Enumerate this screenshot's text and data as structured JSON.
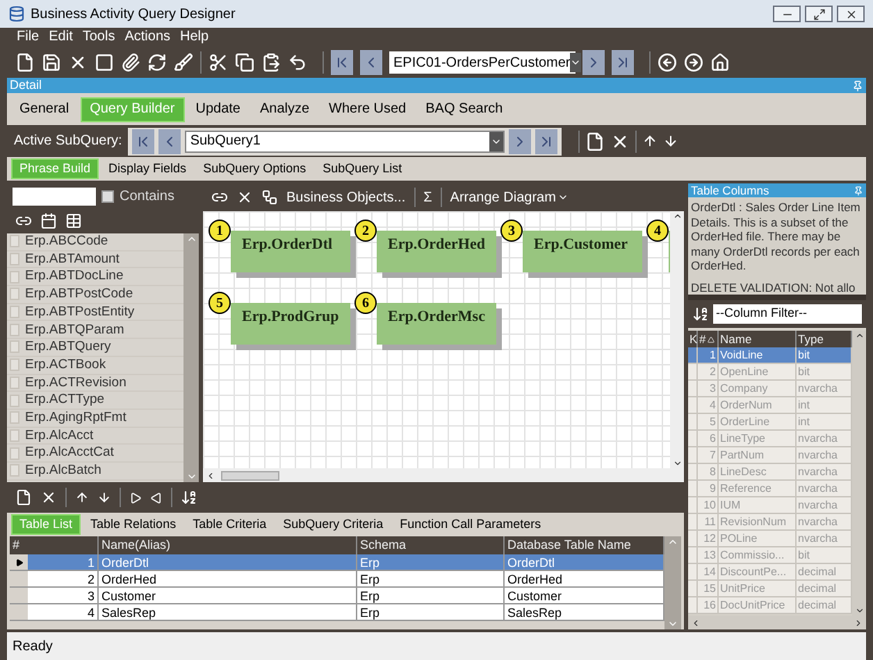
{
  "window": {
    "title": "Business Activity Query Designer"
  },
  "menu": [
    "File",
    "Edit",
    "Tools",
    "Actions",
    "Help"
  ],
  "record_selector": {
    "value": "EPIC01-OrdersPerCustomer"
  },
  "detail_header": "Detail",
  "tabs": [
    {
      "label": "General",
      "selected": false
    },
    {
      "label": "Query Builder",
      "selected": true
    },
    {
      "label": "Update",
      "selected": false
    },
    {
      "label": "Analyze",
      "selected": false
    },
    {
      "label": "Where Used",
      "selected": false
    },
    {
      "label": "BAQ Search",
      "selected": false
    }
  ],
  "active_subquery": {
    "label": "Active SubQuery:",
    "value": "SubQuery1"
  },
  "sub_tabs": [
    {
      "label": "Phrase Build",
      "selected": true
    },
    {
      "label": "Display Fields",
      "selected": false
    },
    {
      "label": "SubQuery Options",
      "selected": false
    },
    {
      "label": "SubQuery List",
      "selected": false
    }
  ],
  "table_search": {
    "contains_label": "Contains",
    "contains_checked": false
  },
  "tables": [
    "Erp.ABCCode",
    "Erp.ABTAmount",
    "Erp.ABTDocLine",
    "Erp.ABTPostCode",
    "Erp.ABTPostEntity",
    "Erp.ABTQParam",
    "Erp.ABTQuery",
    "Erp.ACTBook",
    "Erp.ACTRevision",
    "Erp.ACTType",
    "Erp.AgingRptFmt",
    "Erp.AlcAcct",
    "Erp.AlcAcctCat",
    "Erp.AlcBatch"
  ],
  "diagram_toolbar": {
    "business_objects": "Business Objects...",
    "sum": "Σ",
    "arrange": "Arrange Diagram"
  },
  "diagram_nodes": [
    {
      "number": "1",
      "name": "Erp.OrderDtl"
    },
    {
      "number": "2",
      "name": "Erp.OrderHed"
    },
    {
      "number": "3",
      "name": "Erp.Customer"
    },
    {
      "number": "4"
    },
    {
      "number": "5",
      "name": "Erp.ProdGrup"
    },
    {
      "number": "6",
      "name": "Erp.OrderMsc"
    }
  ],
  "bottom_tabs": [
    {
      "label": "Table List",
      "selected": true
    },
    {
      "label": "Table Relations",
      "selected": false
    },
    {
      "label": "Table Criteria",
      "selected": false
    },
    {
      "label": "SubQuery Criteria",
      "selected": false
    },
    {
      "label": "Function Call Parameters",
      "selected": false
    }
  ],
  "table_list": {
    "columns": [
      "#",
      "Name(Alias)",
      "Schema",
      "Database Table Name"
    ],
    "rows": [
      {
        "cells": [
          "1",
          "OrderDtl",
          "Erp",
          "OrderDtl"
        ],
        "selected": true
      },
      {
        "cells": [
          "2",
          "OrderHed",
          "Erp",
          "OrderHed"
        ],
        "selected": false
      },
      {
        "cells": [
          "3",
          "Customer",
          "Erp",
          "Customer"
        ],
        "selected": false
      },
      {
        "cells": [
          "4",
          "SalesRep",
          "Erp",
          "SalesRep"
        ],
        "selected": false
      }
    ]
  },
  "table_columns": {
    "title": "Table Columns",
    "description": "OrderDtl : Sales Order Line Item Details. This is a subset of the OrderHed file. There may be many OrderDtl records per each OrderHed.",
    "validation": "DELETE VALIDATION:  Not allo",
    "filter_placeholder": "--Column Filter--",
    "columns": [
      "K",
      "#",
      "Name",
      "Type"
    ],
    "rows": [
      {
        "cells": [
          "",
          "1",
          "VoidLine",
          "bit"
        ],
        "selected": true
      },
      {
        "cells": [
          "",
          "2",
          "OpenLine",
          "bit"
        ],
        "selected": false
      },
      {
        "cells": [
          "",
          "3",
          "Company",
          "nvarcha"
        ],
        "selected": false
      },
      {
        "cells": [
          "",
          "4",
          "OrderNum",
          "int"
        ],
        "selected": false
      },
      {
        "cells": [
          "",
          "5",
          "OrderLine",
          "int"
        ],
        "selected": false
      },
      {
        "cells": [
          "",
          "6",
          "LineType",
          "nvarcha"
        ],
        "selected": false
      },
      {
        "cells": [
          "",
          "7",
          "PartNum",
          "nvarcha"
        ],
        "selected": false
      },
      {
        "cells": [
          "",
          "8",
          "LineDesc",
          "nvarcha"
        ],
        "selected": false
      },
      {
        "cells": [
          "",
          "9",
          "Reference",
          "nvarcha"
        ],
        "selected": false
      },
      {
        "cells": [
          "",
          "10",
          "IUM",
          "nvarcha"
        ],
        "selected": false
      },
      {
        "cells": [
          "",
          "11",
          "RevisionNum",
          "nvarcha"
        ],
        "selected": false
      },
      {
        "cells": [
          "",
          "12",
          "POLine",
          "nvarcha"
        ],
        "selected": false
      },
      {
        "cells": [
          "",
          "13",
          "Commissio...",
          "bit"
        ],
        "selected": false
      },
      {
        "cells": [
          "",
          "14",
          "DiscountPe...",
          "decimal"
        ],
        "selected": false
      },
      {
        "cells": [
          "",
          "15",
          "UnitPrice",
          "decimal"
        ],
        "selected": false
      },
      {
        "cells": [
          "",
          "16",
          "DocUnitPrice",
          "decimal"
        ],
        "selected": false
      }
    ]
  },
  "status_bar": "Ready"
}
